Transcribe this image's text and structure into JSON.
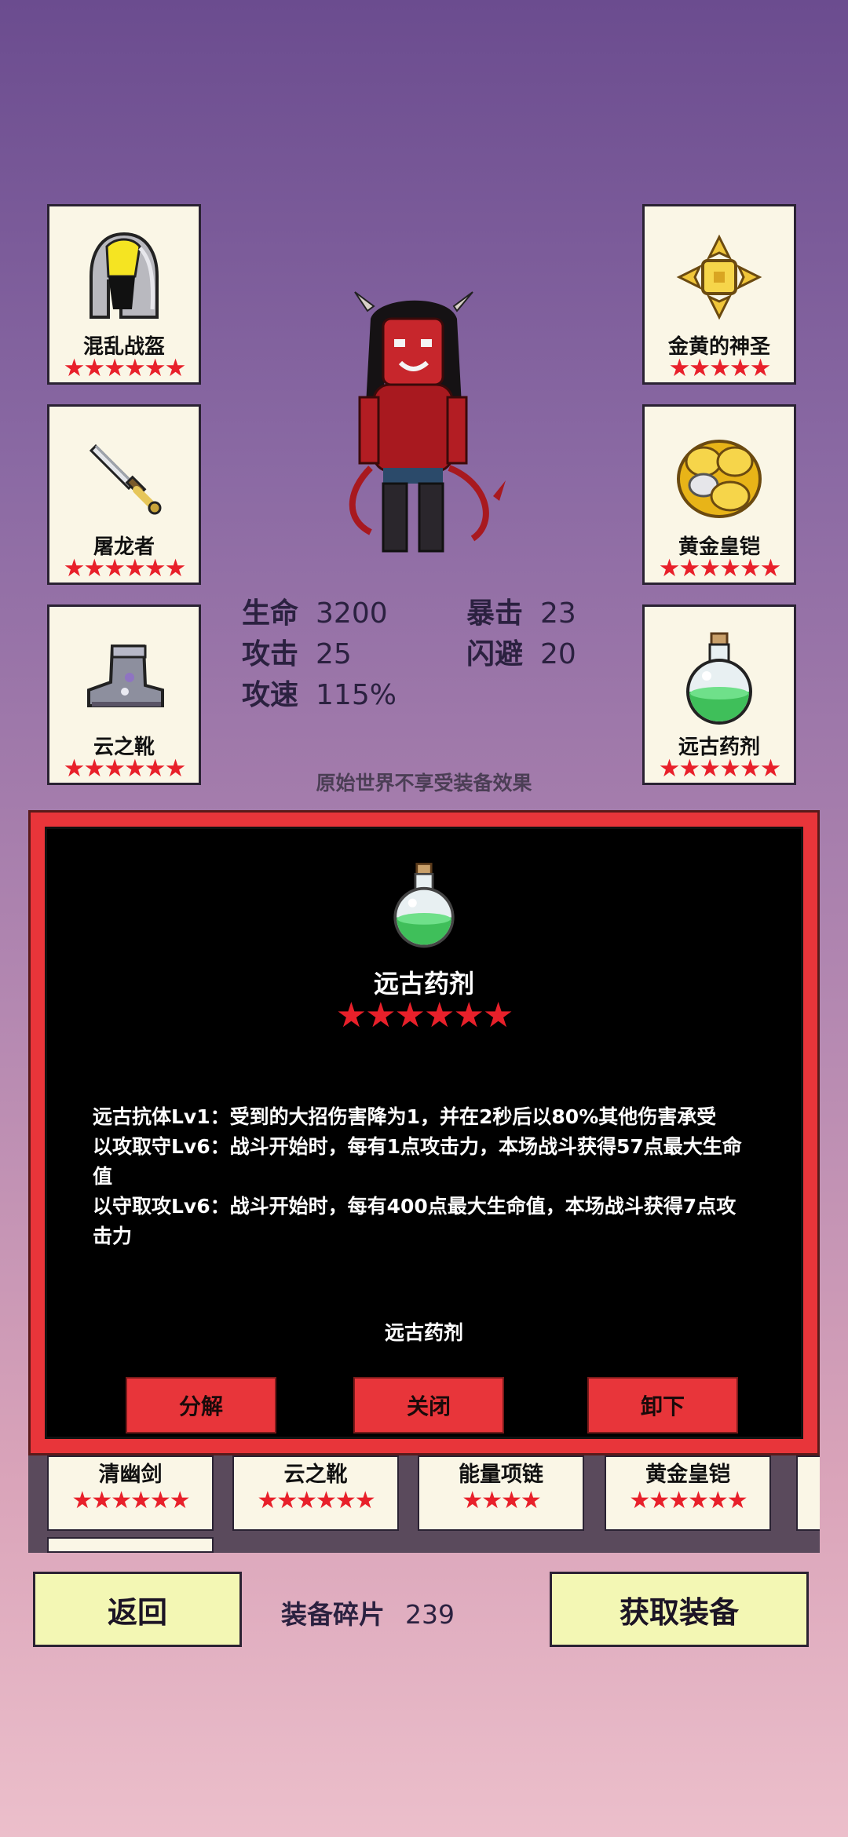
{
  "equipment_slots": {
    "left": [
      {
        "name": "混乱战盔",
        "stars": "★★★★★★",
        "icon": "helmet-icon"
      },
      {
        "name": "屠龙者",
        "stars": "★★★★★★",
        "icon": "dagger-icon"
      },
      {
        "name": "云之靴",
        "stars": "★★★★★★",
        "icon": "boots-icon"
      }
    ],
    "right": [
      {
        "name": "金黄的神圣",
        "stars": "★★★★★",
        "icon": "holy-cross-icon"
      },
      {
        "name": "黄金皇铠",
        "stars": "★★★★★★",
        "icon": "gold-armor-icon"
      },
      {
        "name": "远古药剂",
        "stars": "★★★★★★",
        "icon": "potion-icon"
      }
    ]
  },
  "character": {
    "icon": "demon-girl-sprite"
  },
  "stats": {
    "hp_label": "生命",
    "hp_value": "3200",
    "atk_label": "攻击",
    "atk_value": "25",
    "aspd_label": "攻速",
    "aspd_value": "115%",
    "crit_label": "暴击",
    "crit_value": "23",
    "dodge_label": "闪避",
    "dodge_value": "20"
  },
  "notice": "原始世界不享受装备效果",
  "detail_modal": {
    "icon": "potion-icon",
    "title": "远古药剂",
    "stars": "★★★★★★",
    "desc": [
      "远古抗体Lv1：受到的大招伤害降为1，并在2秒后以80%其他伤害承受",
      "以攻取守Lv6：战斗开始时，每有1点攻击力，本场战斗获得57点最大生命值",
      "以守取攻Lv6：战斗开始时，每有400点最大生命值，本场战斗获得7点攻击力"
    ],
    "item_name": "远古药剂",
    "buttons": {
      "decompose": "分解",
      "close": "关闭",
      "unequip": "卸下"
    }
  },
  "inventory": [
    {
      "name": "清幽剑",
      "stars": "★★★★★★"
    },
    {
      "name": "云之靴",
      "stars": "★★★★★★"
    },
    {
      "name": "能量项链",
      "stars": "★★★★"
    },
    {
      "name": "黄金皇铠",
      "stars": "★★★★★★"
    }
  ],
  "bottom": {
    "back_label": "返回",
    "fragments_label": "装备碎片",
    "fragments_value": "239",
    "get_equipment_label": "获取装备"
  },
  "colors": {
    "star": "#e8202a",
    "modal_border": "#e8353a",
    "button_bg": "#f3f7b4"
  }
}
